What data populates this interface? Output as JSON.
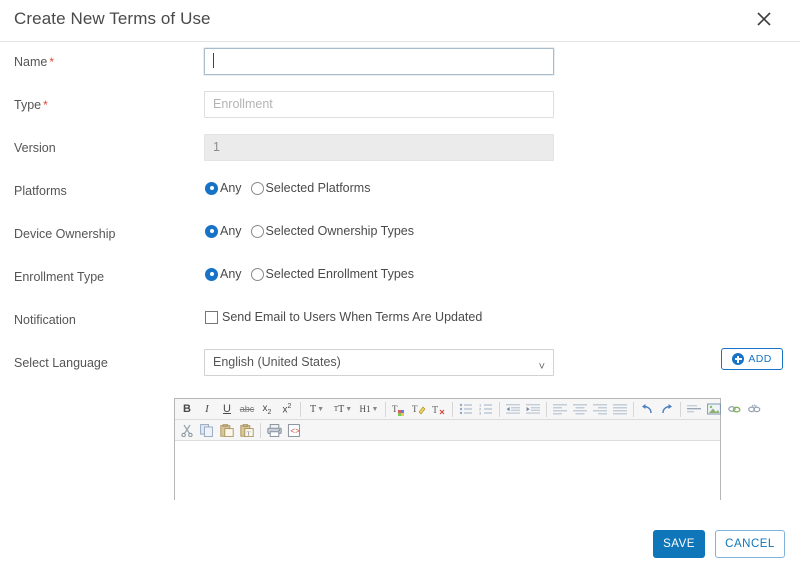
{
  "dialog": {
    "title": "Create New Terms of Use",
    "close_icon": "close-icon"
  },
  "fields": {
    "name": {
      "label": "Name",
      "required": "*",
      "value": "",
      "placeholder": ""
    },
    "type": {
      "label": "Type",
      "required": "*",
      "value": "",
      "placeholder": "Enrollment"
    },
    "version": {
      "label": "Version",
      "value": "1",
      "readonly": true
    },
    "platforms": {
      "label": "Platforms",
      "options": [
        {
          "label": "Any",
          "checked": true
        },
        {
          "label": "Selected Platforms",
          "checked": false
        }
      ]
    },
    "device_ownership": {
      "label": "Device Ownership",
      "options": [
        {
          "label": "Any",
          "checked": true
        },
        {
          "label": "Selected Ownership Types",
          "checked": false
        }
      ]
    },
    "enrollment_type": {
      "label": "Enrollment Type",
      "options": [
        {
          "label": "Any",
          "checked": true
        },
        {
          "label": "Selected Enrollment Types",
          "checked": false
        }
      ]
    },
    "notification": {
      "label": "Notification",
      "checkbox_label": "Send Email to Users When Terms Are Updated",
      "checked": false
    },
    "select_language": {
      "label": "Select Language",
      "value": "English (United States)"
    }
  },
  "add_button": {
    "label": "ADD",
    "icon": "plus-circle-icon"
  },
  "editor": {
    "content": "",
    "toolbar_row1": [
      {
        "name": "bold-icon",
        "glyph": "B"
      },
      {
        "name": "italic-icon",
        "glyph": "I"
      },
      {
        "name": "underline-icon",
        "glyph": "U"
      },
      {
        "name": "strikethrough-icon",
        "glyph": "abc"
      },
      {
        "name": "subscript-icon",
        "glyph": "x₂"
      },
      {
        "name": "superscript-icon",
        "glyph": "x²"
      },
      {
        "name": "font-name-icon",
        "glyph": "T"
      },
      {
        "name": "font-size-icon",
        "glyph": "tT"
      },
      {
        "name": "heading-icon",
        "glyph": "H1"
      },
      {
        "name": "text-color-icon",
        "glyph": "T"
      },
      {
        "name": "highlight-color-icon",
        "glyph": "T"
      },
      {
        "name": "remove-format-icon",
        "glyph": "T"
      },
      {
        "name": "unordered-list-icon",
        "glyph": ""
      },
      {
        "name": "ordered-list-icon",
        "glyph": ""
      },
      {
        "name": "outdent-icon",
        "glyph": ""
      },
      {
        "name": "indent-icon",
        "glyph": ""
      },
      {
        "name": "align-left-icon",
        "glyph": ""
      },
      {
        "name": "align-center-icon",
        "glyph": ""
      },
      {
        "name": "align-right-icon",
        "glyph": ""
      },
      {
        "name": "align-justify-icon",
        "glyph": ""
      },
      {
        "name": "undo-icon",
        "glyph": "↶"
      },
      {
        "name": "redo-icon",
        "glyph": "↷"
      },
      {
        "name": "insert-horizontal-rule-icon",
        "glyph": ""
      },
      {
        "name": "insert-image-icon",
        "glyph": ""
      },
      {
        "name": "insert-link-icon",
        "glyph": ""
      },
      {
        "name": "unlink-icon",
        "glyph": ""
      }
    ],
    "toolbar_row2": [
      {
        "name": "cut-icon",
        "glyph": "✂"
      },
      {
        "name": "copy-icon",
        "glyph": ""
      },
      {
        "name": "paste-icon",
        "glyph": ""
      },
      {
        "name": "paste-as-text-icon",
        "glyph": ""
      },
      {
        "name": "print-icon",
        "glyph": ""
      },
      {
        "name": "view-source-icon",
        "glyph": ""
      }
    ]
  },
  "footer": {
    "save_label": "SAVE",
    "cancel_label": "CANCEL"
  },
  "colors": {
    "accent": "#1076ba",
    "radio_checked": "#1673c6",
    "required": "#e8432f",
    "title_text": "#4a4a4a"
  }
}
